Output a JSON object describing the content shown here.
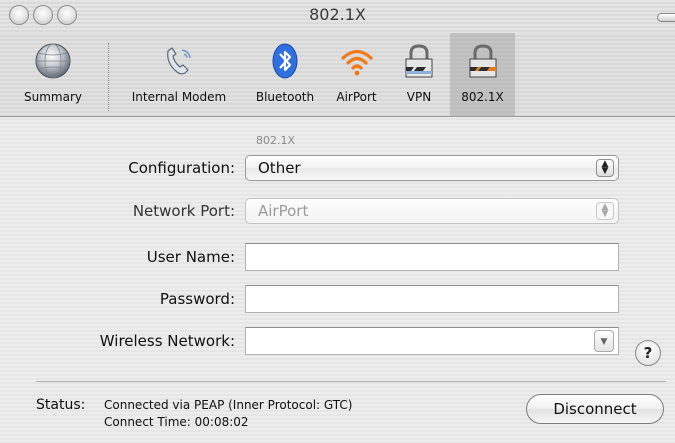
{
  "window": {
    "title": "802.1X"
  },
  "toolbar": {
    "items": [
      {
        "label": "Summary",
        "icon": "globe-icon"
      },
      {
        "label": "Internal Modem",
        "icon": "phone-icon"
      },
      {
        "label": "Bluetooth",
        "icon": "bluetooth-icon"
      },
      {
        "label": "AirPort",
        "icon": "airport-wifi-icon"
      },
      {
        "label": "VPN",
        "icon": "vpn-lock-icon"
      },
      {
        "label": "802.1X",
        "icon": "lock-icon",
        "selected": true
      }
    ]
  },
  "form": {
    "section_tag": "802.1X",
    "configuration": {
      "label": "Configuration:",
      "value": "Other"
    },
    "network_port": {
      "label": "Network Port:",
      "value": "AirPort",
      "disabled": true
    },
    "user_name": {
      "label": "User Name:",
      "value": ""
    },
    "password": {
      "label": "Password:",
      "value": ""
    },
    "wireless_network": {
      "label": "Wireless Network:",
      "value": ""
    },
    "help": "?"
  },
  "status": {
    "label": "Status:",
    "line1": "Connected via PEAP (Inner Protocol: GTC)",
    "line2": "Connect Time: 00:08:02"
  },
  "buttons": {
    "disconnect": "Disconnect"
  },
  "colors": {
    "bluetooth_blue": "#2f6fe0",
    "airport_orange": "#f07a17",
    "vpn_stripe_orange": "#e87a1a"
  }
}
